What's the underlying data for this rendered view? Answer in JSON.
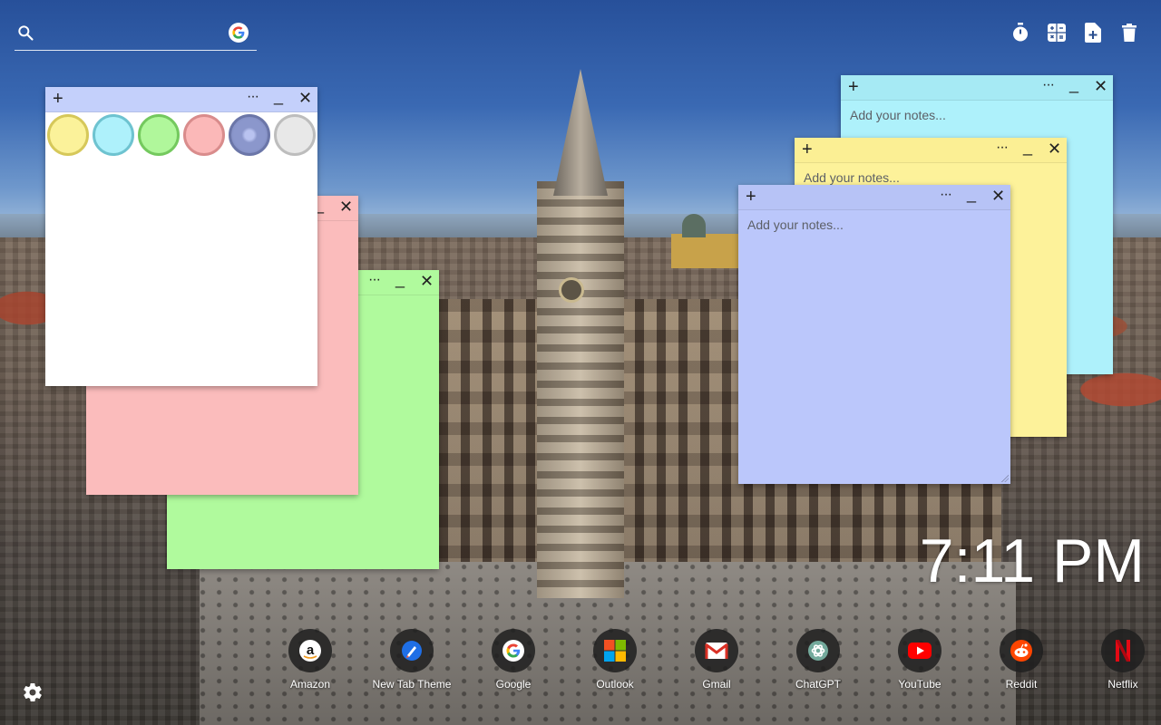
{
  "search": {
    "placeholder": "",
    "value": ""
  },
  "toolbar": {
    "items": [
      {
        "icon": "timer-icon"
      },
      {
        "icon": "calculator-icon"
      },
      {
        "icon": "add-note-icon"
      },
      {
        "icon": "trash-icon"
      }
    ]
  },
  "notes": {
    "glyphs": {
      "add": "+",
      "more": "···",
      "minimize": "_",
      "close": "✕"
    },
    "palette": {
      "swatches": [
        {
          "color": "#fbf29a",
          "border": "#d6c85a"
        },
        {
          "color": "#aef1fb",
          "border": "#6ec3d0"
        },
        {
          "color": "#b0f79b",
          "border": "#74c95e"
        },
        {
          "color": "#fbb8b8",
          "border": "#d98c8c"
        },
        {
          "color": "#8b97cc",
          "border": "#6b76a8"
        },
        {
          "color": "#e8e8e8",
          "border": "#bdbdbd"
        }
      ]
    },
    "cyan": {
      "placeholder": "Add your notes...",
      "color": "#aef1fb",
      "head": "#a6eaf4"
    },
    "yellow": {
      "placeholder": "Add your notes...",
      "color": "#fdf29a",
      "head": "#fbef94"
    },
    "blue": {
      "placeholder": "Add your notes...",
      "color": "#bbc7fb",
      "head": "#b7c3f6"
    },
    "pink": {
      "color": "#fbbcbc"
    },
    "green": {
      "color": "#b0fa9d"
    },
    "white": {
      "color": "#ffffff",
      "head": "#c4d0fb"
    }
  },
  "clock": {
    "time": "7:11 PM"
  },
  "shortcuts": [
    {
      "label": "Amazon",
      "icon": "amazon-icon"
    },
    {
      "label": "New Tab Theme",
      "icon": "new-tab-theme-icon"
    },
    {
      "label": "Google",
      "icon": "google-icon"
    },
    {
      "label": "Outlook",
      "icon": "outlook-icon"
    },
    {
      "label": "Gmail",
      "icon": "gmail-icon"
    },
    {
      "label": "ChatGPT",
      "icon": "chatgpt-icon"
    },
    {
      "label": "YouTube",
      "icon": "youtube-icon"
    },
    {
      "label": "Reddit",
      "icon": "reddit-icon"
    },
    {
      "label": "Netflix",
      "icon": "netflix-icon"
    }
  ]
}
